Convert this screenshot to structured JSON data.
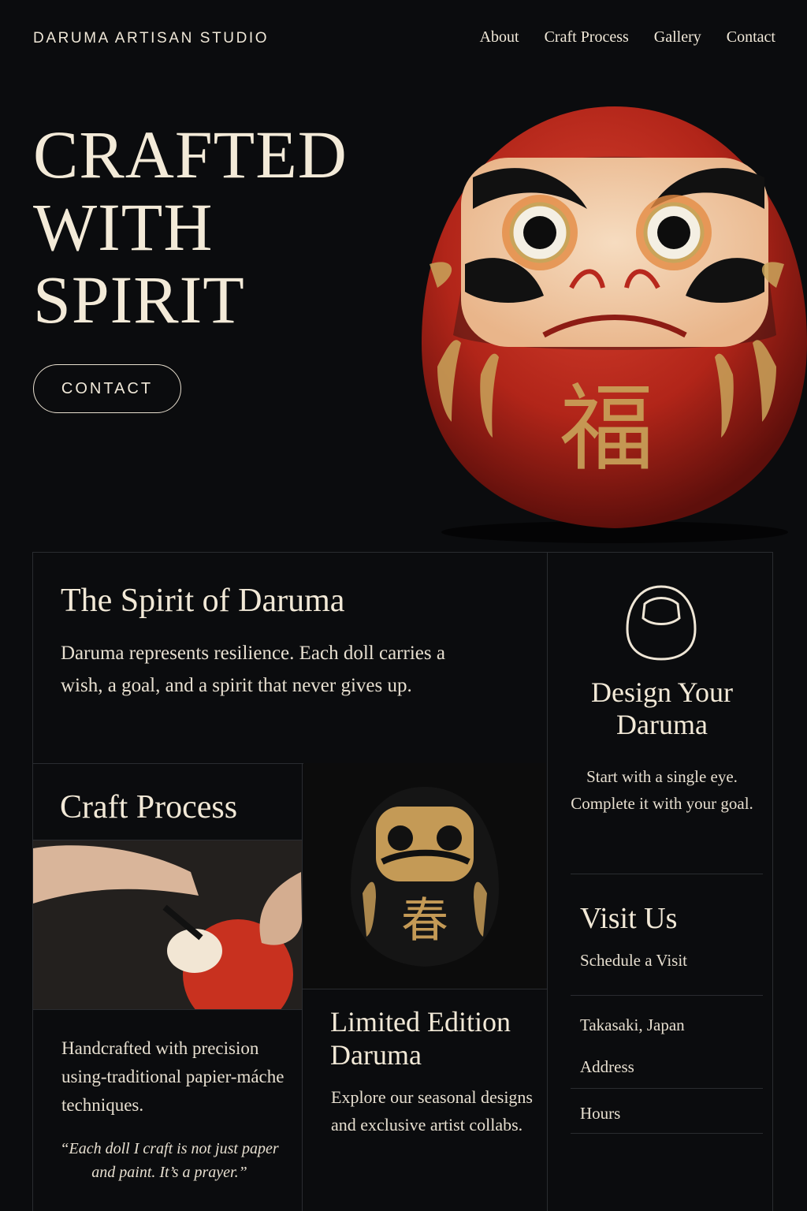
{
  "nav": {
    "brand": "DARUMA ARTISAN STUDIO",
    "items": [
      "About",
      "Craft Process",
      "Gallery",
      "Contact"
    ]
  },
  "hero": {
    "title_lines": [
      "CRAFTED",
      "WITH",
      "SPIRIT"
    ],
    "cta_label": "CONTACT"
  },
  "spirit": {
    "title": "The Spirit of Daruma",
    "text": "Daruma represents resilience.  Each doll carries a wish, a goal, and a spirit that never gives up."
  },
  "craft": {
    "title": "Craft Process",
    "text": "Handcrafted with precision using-traditional papier-máche techniques.",
    "quote": "“Each doll I craft is not just paper and paint. It’s a prayer.”"
  },
  "limited": {
    "title": "Limited Edition Daruma",
    "text": "Explore our seasonal designs and exclusive artist collabs."
  },
  "design": {
    "title": "Design Your Daruma",
    "text": "Start with a single eye. Complete it with your goal."
  },
  "visit": {
    "title": "Visit Us",
    "link": "Schedule a Visit",
    "location": "Takasaki, Japan",
    "address": "Address",
    "hours": "Hours"
  },
  "colors": {
    "background": "#0b0c0e",
    "accent_red": "#b8281d",
    "gold": "#c9a45a",
    "text": "#efe6d6"
  }
}
